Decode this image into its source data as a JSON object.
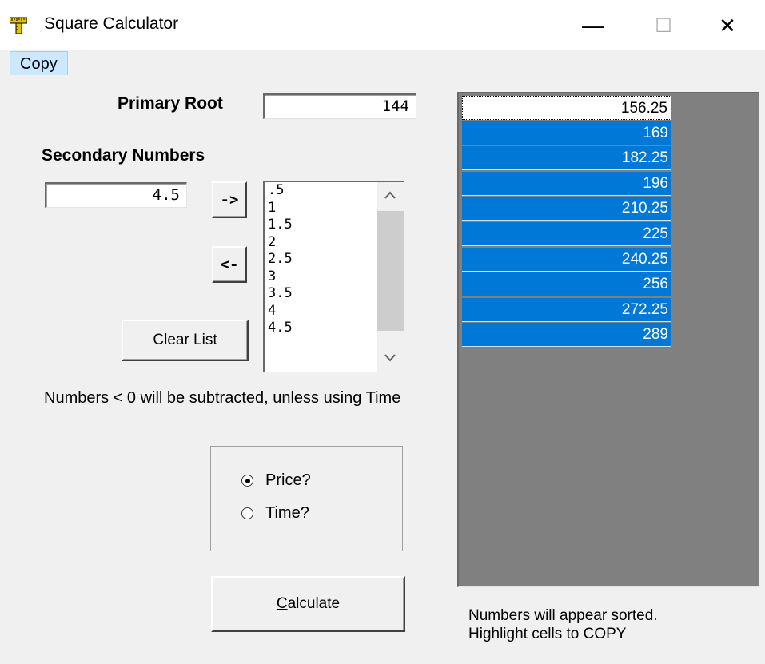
{
  "window": {
    "title": "Square Calculator",
    "minimize_glyph": "—",
    "maximize_glyph": "☐",
    "close_glyph": "✕"
  },
  "menu": {
    "copy": "Copy"
  },
  "primary": {
    "label": "Primary Root",
    "value": "144"
  },
  "secondary": {
    "label": "Secondary Numbers",
    "input_value": "4.5",
    "add_button": "->",
    "remove_button": "<-",
    "clear_button": "Clear List",
    "list_items": [
      ".5",
      "1",
      "1.5",
      "2",
      "2.5",
      "3",
      "3.5",
      "4",
      "4.5"
    ]
  },
  "note_subtract": "Numbers <  0 will be subtracted, unless using Time",
  "mode": {
    "price_label": "Price?",
    "time_label": "Time?",
    "selected": "price"
  },
  "calculate_button": {
    "underlined": "C",
    "rest": "alculate"
  },
  "results": {
    "values": [
      "156.25",
      "169",
      "182.25",
      "196",
      "210.25",
      "225",
      "240.25",
      "256",
      "272.25",
      "289"
    ]
  },
  "note_sorted_line1": "Numbers will appear sorted.",
  "note_sorted_line2": "Highlight cells to COPY",
  "colors": {
    "selection": "#0078d7",
    "grid_background": "#808080",
    "menu_highlight": "#cce8ff"
  }
}
